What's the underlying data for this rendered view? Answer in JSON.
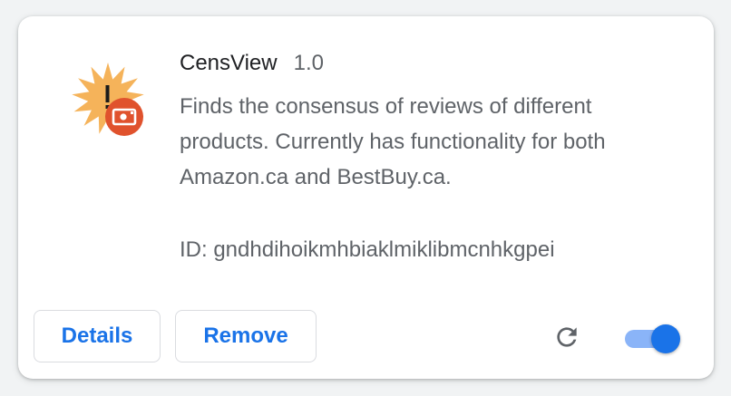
{
  "extension": {
    "name": "CensView",
    "version": "1.0",
    "description": "Finds the consensus of reviews of different products. Currently has functionality for both Amazon.ca and BestBuy.ca.",
    "id_text": "ID: gndhdihoikmhbiaklmiklibmcnhkgpei",
    "icon": "starburst-exclamation-icon",
    "badge_icon": "camera-badge-icon",
    "enabled": true
  },
  "actions": {
    "details_label": "Details",
    "remove_label": "Remove",
    "reload_icon": "reload-icon",
    "toggle_icon": "enable-toggle"
  },
  "colors": {
    "accent": "#1a73e8",
    "toggle_track": "#8ab4f8",
    "badge": "#e0522d",
    "starburst": "#f5b35a",
    "text_primary": "#202124",
    "text_secondary": "#5f6368"
  }
}
